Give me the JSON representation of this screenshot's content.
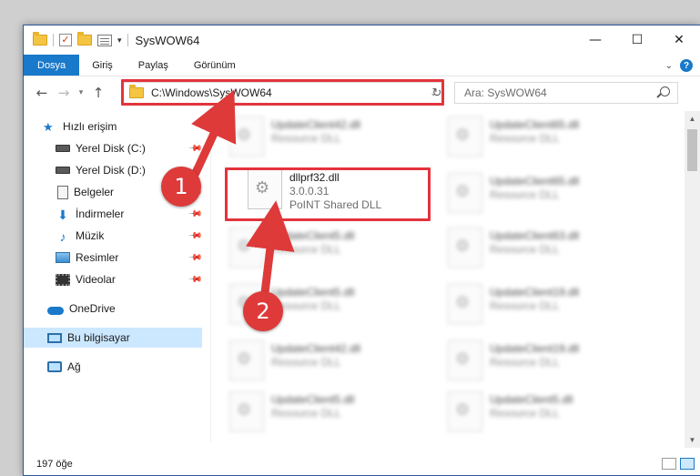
{
  "titlebar": {
    "title": "SysWOW64",
    "minimize_glyph": "—",
    "maximize_glyph": "☐",
    "close_glyph": "✕"
  },
  "ribbon": {
    "tabs": [
      "Dosya",
      "Giriş",
      "Paylaş",
      "Görünüm"
    ],
    "help_glyph": "?"
  },
  "address_bar": {
    "path": "C:\\Windows\\SysWOW64"
  },
  "search": {
    "placeholder": "Ara: SysWOW64"
  },
  "nav_pane": {
    "items": [
      {
        "label": "Hızlı erişim",
        "icon": "star-icon"
      },
      {
        "label": "Yerel Disk (C:)",
        "icon": "drive-icon"
      },
      {
        "label": "Yerel Disk (D:)",
        "icon": "drive-icon"
      },
      {
        "label": "Belgeler",
        "icon": "documents-icon"
      },
      {
        "label": "İndirmeler",
        "icon": "downloads-icon"
      },
      {
        "label": "Müzik",
        "icon": "music-icon"
      },
      {
        "label": "Resimler",
        "icon": "pictures-icon"
      },
      {
        "label": "Videolar",
        "icon": "videos-icon"
      },
      {
        "label": "OneDrive",
        "icon": "onedrive-icon"
      },
      {
        "label": "Bu bilgisayar",
        "icon": "this-pc-icon"
      },
      {
        "label": "Ağ",
        "icon": "network-icon"
      }
    ]
  },
  "files": {
    "featured": {
      "name": "dllprf32.dll",
      "version": "3.0.0.31",
      "description": "PoINT Shared DLL"
    },
    "blurred": [
      {
        "name": "UpdateClient42.dll",
        "desc": "Resource DLL"
      },
      {
        "name": "UpdateClient65.dll",
        "desc": "Resource DLL"
      },
      {
        "name": "UpdateClient65.dll",
        "desc": "Resource DLL"
      },
      {
        "name": "UpdateClient5.dll",
        "desc": "Resource DLL"
      },
      {
        "name": "UpdateClient63.dll",
        "desc": "Resource DLL"
      },
      {
        "name": "UpdateClient5.dll",
        "desc": "Resource DLL"
      },
      {
        "name": "UpdateClient19.dll",
        "desc": "Resource DLL"
      },
      {
        "name": "UpdateClient42.dll",
        "desc": "Resource DLL"
      },
      {
        "name": "UpdateClient19.dll",
        "desc": "Resource DLL"
      },
      {
        "name": "UpdateClient5.dll",
        "desc": "Resource DLL"
      },
      {
        "name": "UpdateClient5.dll",
        "desc": "Resource DLL"
      }
    ]
  },
  "status": {
    "item_count": "197 öğe"
  },
  "annotations": {
    "callout_1": "1",
    "callout_2": "2",
    "color": "#de3a3a"
  }
}
